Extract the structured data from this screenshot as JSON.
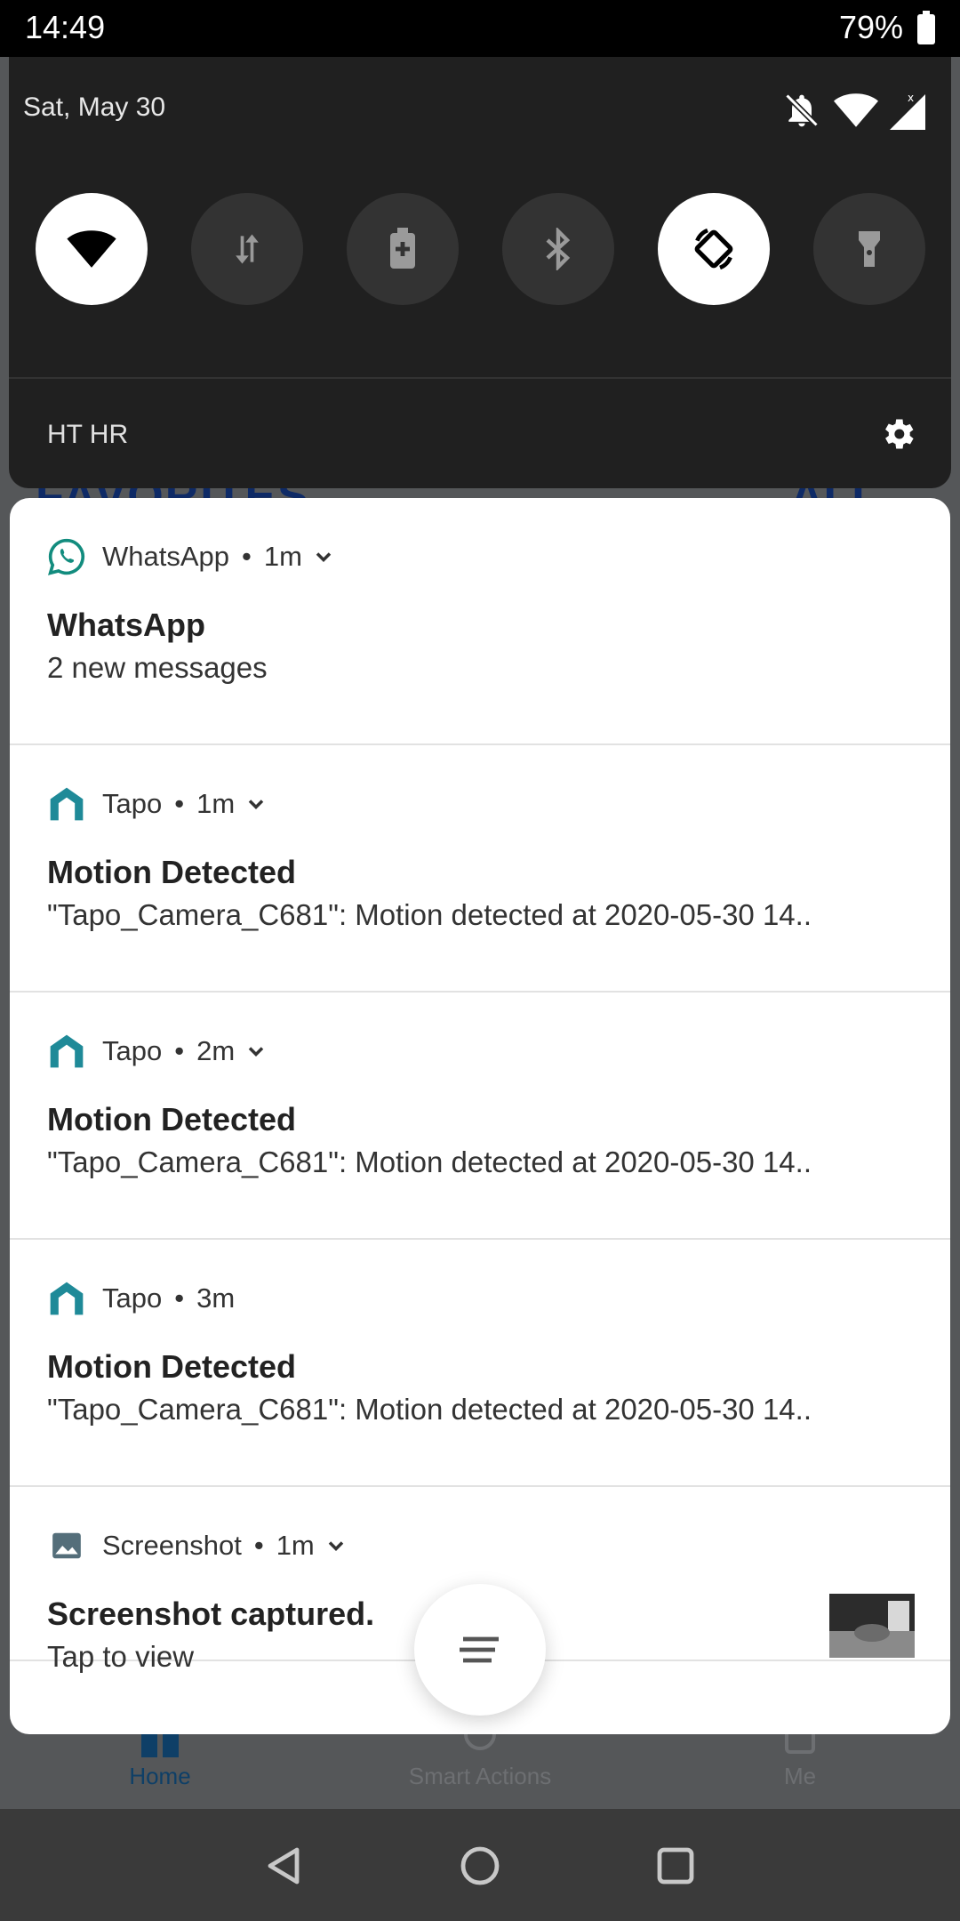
{
  "status_bar": {
    "time": "14:49",
    "battery_percent": "79%"
  },
  "quick_settings": {
    "date": "Sat, May 30",
    "carrier": "HT HR",
    "tiles": [
      {
        "name": "wifi",
        "icon": "wifi-icon",
        "on": true
      },
      {
        "name": "mobile-data",
        "icon": "mobile-data-icon",
        "on": false
      },
      {
        "name": "battery-saver",
        "icon": "battery-saver-icon",
        "on": false
      },
      {
        "name": "bluetooth",
        "icon": "bluetooth-icon",
        "on": false
      },
      {
        "name": "auto-rotate",
        "icon": "auto-rotate-icon",
        "on": true
      },
      {
        "name": "flashlight",
        "icon": "flashlight-icon",
        "on": false
      }
    ]
  },
  "background_app": {
    "favorites_label": "FAVORITES",
    "all_label": "ALL",
    "tabs": [
      {
        "label": "Home",
        "active": true
      },
      {
        "label": "Smart Actions",
        "active": false
      },
      {
        "label": "Me",
        "active": false
      }
    ]
  },
  "notifications": [
    {
      "app": "WhatsApp",
      "time": "1m",
      "expandable": true,
      "title": "WhatsApp",
      "text": "2 new messages",
      "icon": "whatsapp-icon",
      "accent": "#128c7e"
    },
    {
      "app": "Tapo",
      "time": "1m",
      "expandable": true,
      "title": "Motion Detected",
      "text": "\"Tapo_Camera_C681\": Motion detected at 2020-05-30 14..",
      "icon": "tapo-icon",
      "accent": "#1f8a98"
    },
    {
      "app": "Tapo",
      "time": "2m",
      "expandable": true,
      "title": "Motion Detected",
      "text": "\"Tapo_Camera_C681\": Motion detected at 2020-05-30 14..",
      "icon": "tapo-icon",
      "accent": "#1f8a98"
    },
    {
      "app": "Tapo",
      "time": "3m",
      "expandable": false,
      "title": "Motion Detected",
      "text": "\"Tapo_Camera_C681\": Motion detected at 2020-05-30 14..",
      "icon": "tapo-icon",
      "accent": "#1f8a98"
    },
    {
      "app": "Screenshot",
      "time": "1m",
      "expandable": true,
      "title": "Screenshot captured.",
      "text": "Tap to view",
      "icon": "screenshot-image-icon",
      "accent": "#546e7a"
    }
  ]
}
